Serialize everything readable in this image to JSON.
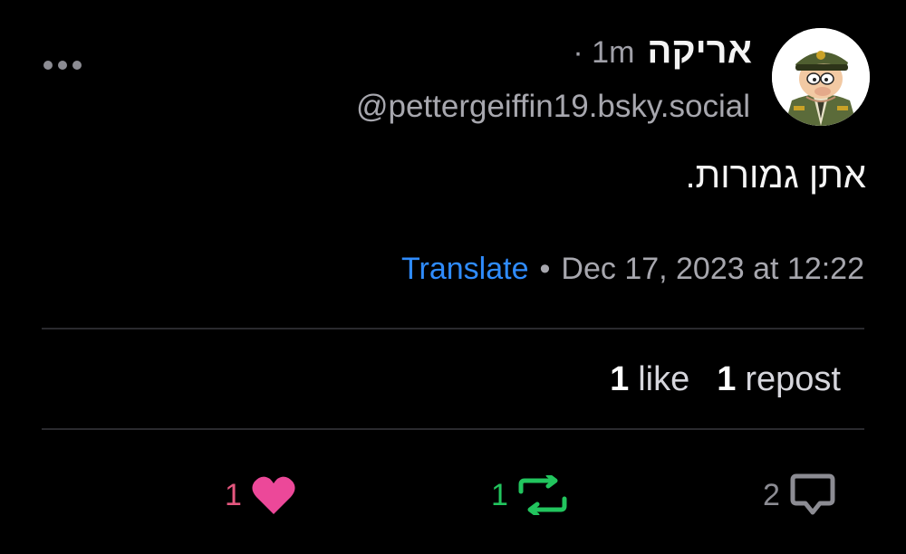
{
  "post": {
    "author": {
      "display_name": "אריקה",
      "handle": "@pettergeiffin19.bsky.social",
      "avatar": "cartoon-avatar-icon"
    },
    "time_ago": "· 1m",
    "text": "אתן גמורות.",
    "translate_label": "Translate",
    "separator": "•",
    "timestamp": "Dec 17, 2023 at 12:22"
  },
  "stats": {
    "likes_count": "1",
    "likes_label": "like",
    "reposts_count": "1",
    "reposts_label": "repost"
  },
  "actions": {
    "like_count": "1",
    "repost_count": "1",
    "reply_count": "2"
  },
  "colors": {
    "background": "#000000",
    "link": "#2f8cff",
    "like": "#ec4899",
    "repost": "#22c55e",
    "muted": "#8c8c93"
  }
}
